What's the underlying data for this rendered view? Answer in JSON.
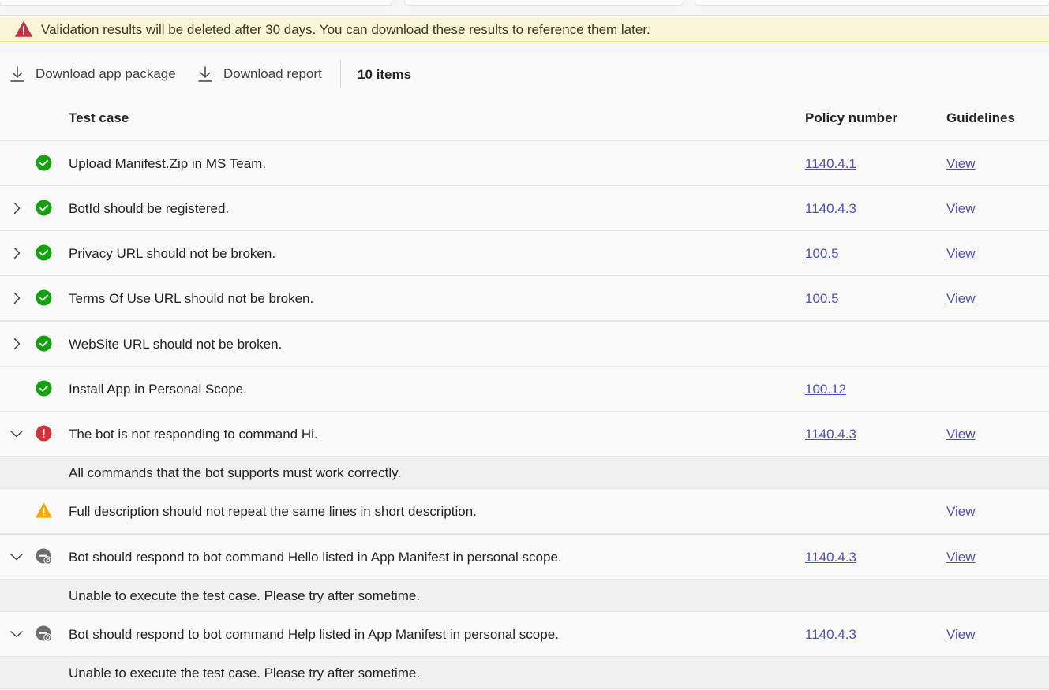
{
  "banner": {
    "message": "Validation results will be deleted after 30 days. You can download these results to reference them later.",
    "icon": "warning-triangle-icon",
    "color": "#c4314b"
  },
  "toolbar": {
    "download_package_label": "Download app package",
    "download_report_label": "Download report",
    "item_count": "10 items"
  },
  "table": {
    "headers": {
      "test_case": "Test case",
      "policy_number": "Policy number",
      "guidelines": "Guidelines"
    },
    "rows": [
      {
        "name": "Upload Manifest.Zip in MS Team.",
        "status": "passed",
        "chevron": "none",
        "policy": "1140.4.1",
        "guideline": "View"
      },
      {
        "name": "BotId should be registered.",
        "status": "passed",
        "chevron": "right",
        "policy": "1140.4.3",
        "guideline": "View"
      },
      {
        "name": "Privacy URL should not be broken.",
        "status": "passed",
        "chevron": "right",
        "policy": "100.5",
        "guideline": "View"
      },
      {
        "name": "Terms Of Use URL should not be broken.",
        "status": "passed",
        "chevron": "right",
        "policy": "100.5",
        "guideline": "View"
      },
      {
        "name": "WebSite URL should not be broken.",
        "status": "passed",
        "chevron": "right",
        "policy": "",
        "guideline": ""
      },
      {
        "name": "Install App in Personal Scope.",
        "status": "passed",
        "chevron": "none",
        "policy": "100.12",
        "guideline": ""
      },
      {
        "name": "The bot is not responding to command Hi.",
        "status": "failed",
        "chevron": "down",
        "policy": "1140.4.3",
        "guideline": "View",
        "detail": "All commands that the bot supports must work correctly."
      },
      {
        "name": "Full description should not repeat the same lines in short description.",
        "status": "warning",
        "chevron": "none",
        "policy": "",
        "guideline": "View"
      },
      {
        "name": "Bot should respond to bot command Hello listed in App Manifest in personal scope.",
        "status": "skipped",
        "chevron": "down",
        "policy": "1140.4.3",
        "guideline": "View",
        "detail": "Unable to execute the test case. Please try after sometime."
      },
      {
        "name": "Bot should respond to bot command Help listed in App Manifest in personal scope.",
        "status": "skipped",
        "chevron": "down",
        "policy": "1140.4.3",
        "guideline": "View",
        "detail": "Unable to execute the test case. Please try after sometime."
      }
    ]
  },
  "colors": {
    "passed": "#13a10e",
    "failed": "#d13438",
    "warning": "#f7a800",
    "skipped": "#6e6e6e",
    "link": "#4f52b2",
    "banner_bg": "#fbf6d9"
  }
}
